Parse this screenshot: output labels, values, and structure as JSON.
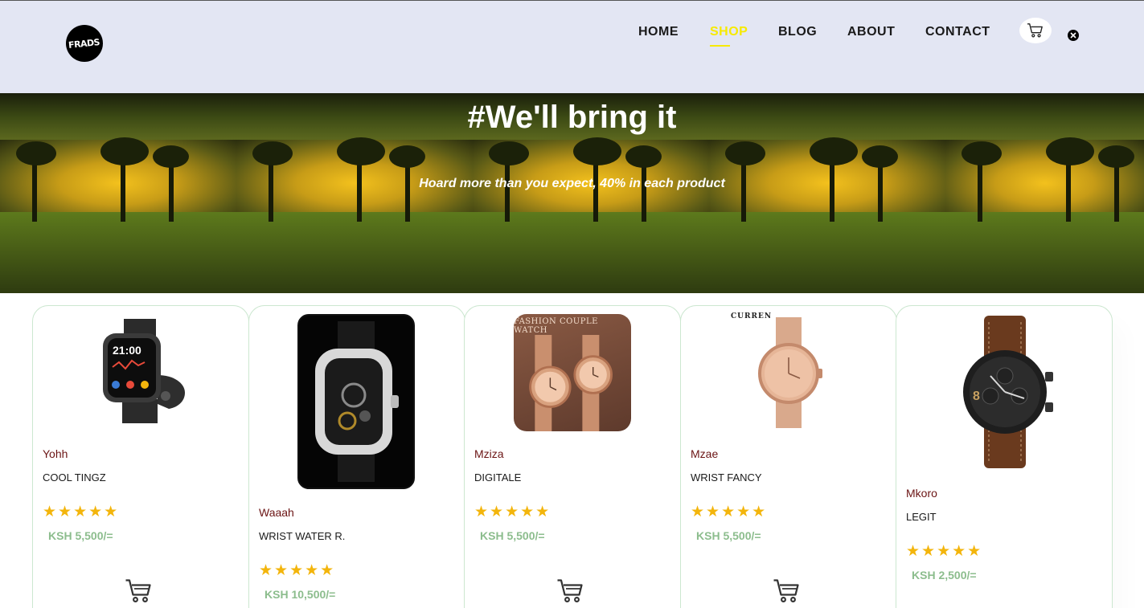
{
  "header": {
    "logo_text": "FRADS",
    "nav": [
      {
        "label": "HOME",
        "active": false
      },
      {
        "label": "SHOP",
        "active": true
      },
      {
        "label": "BLOG",
        "active": false
      },
      {
        "label": "ABOUT",
        "active": false
      },
      {
        "label": "CONTACT",
        "active": false
      }
    ],
    "cart_icon": "shopping-cart-icon",
    "close_icon": "close-icon"
  },
  "hero": {
    "title": "#We'll bring it",
    "subtitle": "Hoard more than you expect, 40% in each product"
  },
  "colors": {
    "header_bg": "#e3e6f3",
    "nav_active": "#f7ea00",
    "brand_text": "#6b1414",
    "price": "#8cbd8d",
    "stars": "#f3b50c"
  },
  "products": [
    {
      "brand": "Yohh",
      "name": "COOL TINGZ",
      "rating": 5,
      "price": "KSH 5,500/=",
      "image": "smartwatch-image"
    },
    {
      "brand": "Waaah",
      "name": "WRIST WATER R.",
      "rating": 5,
      "price": "KSH 10,500/=",
      "image": "skeleton-watch-image"
    },
    {
      "brand": "Mziza",
      "name": "DIGITALE",
      "rating": 5,
      "price": "KSH 5,500/=",
      "image": "couple-watch-image",
      "image_text": "FASHION COUPLE WATCH"
    },
    {
      "brand": "Mzae",
      "name": "WRIST FANCY",
      "rating": 5,
      "price": "KSH 5,500/=",
      "image": "rose-gold-watch-image",
      "image_text": "CURREN"
    },
    {
      "brand": "Mkoro",
      "name": "LEGIT",
      "rating": 5,
      "price": "KSH 2,500/=",
      "image": "chronograph-watch-image"
    }
  ]
}
